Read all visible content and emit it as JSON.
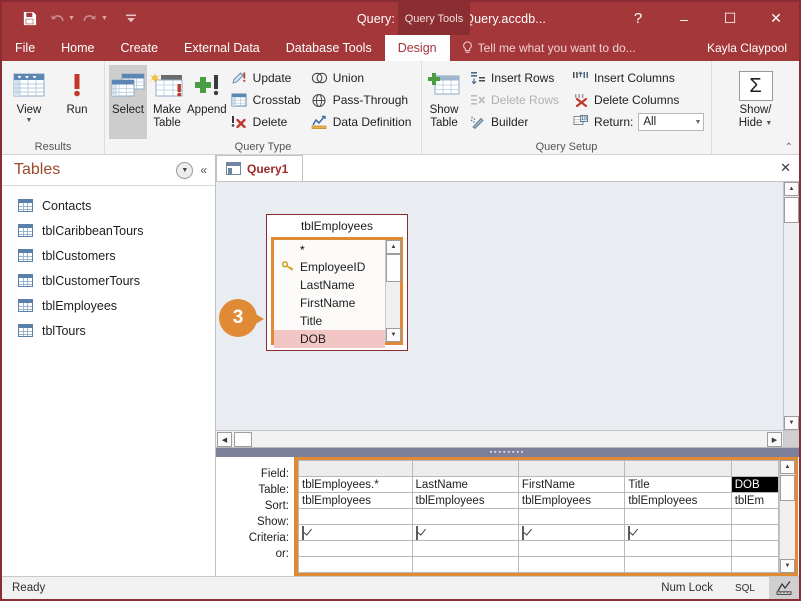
{
  "window": {
    "title": "Query: Database- \\Query.accdb...",
    "context_tab": "Query Tools",
    "quick_access": [
      {
        "name": "save-icon",
        "label": "Save"
      },
      {
        "name": "undo-icon",
        "label": "Undo"
      },
      {
        "name": "redo-icon",
        "label": "Redo"
      },
      {
        "name": "customize-qat-icon",
        "label": "Customize Quick Access Toolbar"
      }
    ],
    "controls": [
      {
        "name": "help-button",
        "label": "?"
      },
      {
        "name": "minimize-button",
        "label": "–"
      },
      {
        "name": "restore-button",
        "label": "☐"
      },
      {
        "name": "close-button",
        "label": "✕"
      }
    ]
  },
  "ribbon": {
    "tabs": [
      {
        "label": "File",
        "active": false
      },
      {
        "label": "Home",
        "active": false
      },
      {
        "label": "Create",
        "active": false
      },
      {
        "label": "External Data",
        "active": false
      },
      {
        "label": "Database Tools",
        "active": false
      },
      {
        "label": "Design",
        "active": true
      }
    ],
    "tell_me": "Tell me what you want to do...",
    "account": "Kayla Claypool",
    "groups": [
      {
        "label": "Results",
        "buttons": [
          {
            "label": "View",
            "name": "view-button",
            "has_dropdown": true
          },
          {
            "label": "Run",
            "name": "run-button",
            "has_dropdown": false
          }
        ]
      },
      {
        "label": "Query Type",
        "big_buttons": [
          {
            "label": "Select",
            "name": "select-query-button",
            "selected": true
          },
          {
            "label": "Make\nTable",
            "name": "make-table-query-button",
            "selected": false
          },
          {
            "label": "Append",
            "name": "append-query-button",
            "selected": false
          }
        ],
        "small_buttons_col1": [
          {
            "label": "Update",
            "name": "update-query-button",
            "disabled": false
          },
          {
            "label": "Crosstab",
            "name": "crosstab-query-button",
            "disabled": false
          },
          {
            "label": "Delete",
            "name": "delete-query-button",
            "disabled": false
          }
        ],
        "small_buttons_col2": [
          {
            "label": "Union",
            "name": "union-query-button",
            "disabled": false
          },
          {
            "label": "Pass-Through",
            "name": "pass-through-query-button",
            "disabled": false
          },
          {
            "label": "Data Definition",
            "name": "data-definition-query-button",
            "disabled": false
          }
        ]
      },
      {
        "label": "Query Setup",
        "show_table": "Show\nTable",
        "show_table_line1": "Show",
        "show_table_line2": "Table",
        "small_buttons_col1": [
          {
            "label": "Insert Rows",
            "name": "insert-rows-button",
            "disabled": false
          },
          {
            "label": "Delete Rows",
            "name": "delete-rows-button",
            "disabled": true
          },
          {
            "label": "Builder",
            "name": "builder-button",
            "disabled": false
          }
        ],
        "small_buttons_col2": [
          {
            "label": "Insert Columns",
            "name": "insert-columns-button",
            "disabled": false
          },
          {
            "label": "Delete Columns",
            "name": "delete-columns-button",
            "disabled": false
          }
        ],
        "return_label": "Return:",
        "return_value": "All"
      },
      {
        "label": "",
        "show_hide_line1": "Show/",
        "show_hide_line2": "Hide",
        "totals_symbol": "Σ"
      }
    ],
    "collapse_label": "⌃"
  },
  "navpane": {
    "title": "Tables",
    "items": [
      {
        "label": "Contacts",
        "name": "nav-item-contacts"
      },
      {
        "label": "tblCaribbeanTours",
        "name": "nav-item-tblcaribbeantours"
      },
      {
        "label": "tblCustomers",
        "name": "nav-item-tblcustomers"
      },
      {
        "label": "tblCustomerTours",
        "name": "nav-item-tblcustomertours"
      },
      {
        "label": "tblEmployees",
        "name": "nav-item-tblemployees"
      },
      {
        "label": "tblTours",
        "name": "nav-item-tbltours"
      }
    ]
  },
  "document": {
    "tab_label": "Query1",
    "close_label": "✕"
  },
  "field_list": {
    "table_name": "tblEmployees",
    "fields": [
      {
        "label": "*",
        "key": false,
        "selected": false
      },
      {
        "label": "EmployeeID",
        "key": true,
        "selected": false
      },
      {
        "label": "LastName",
        "key": false,
        "selected": false
      },
      {
        "label": "FirstName",
        "key": false,
        "selected": false
      },
      {
        "label": "Title",
        "key": false,
        "selected": false
      },
      {
        "label": "DOB",
        "key": false,
        "selected": true
      }
    ]
  },
  "callout": {
    "number": "3"
  },
  "query_grid": {
    "row_labels": [
      "Field:",
      "Table:",
      "Sort:",
      "Show:",
      "Criteria:",
      "or:"
    ],
    "columns": [
      {
        "field": "tblEmployees.*",
        "table": "tblEmployees",
        "sort": "",
        "show": true,
        "criteria": "",
        "or": "",
        "field_selected": false
      },
      {
        "field": "LastName",
        "table": "tblEmployees",
        "sort": "",
        "show": true,
        "criteria": "",
        "or": "",
        "field_selected": false
      },
      {
        "field": "FirstName",
        "table": "tblEmployees",
        "sort": "",
        "show": true,
        "criteria": "",
        "or": "",
        "field_selected": false
      },
      {
        "field": "Title",
        "table": "tblEmployees",
        "sort": "",
        "show": true,
        "criteria": "",
        "or": "",
        "field_selected": false
      },
      {
        "field": "DOB",
        "table": "tblEm",
        "sort": "",
        "show": false,
        "criteria": "",
        "or": "",
        "field_selected": true
      }
    ]
  },
  "statusbar": {
    "message": "Ready",
    "num_lock": "Num Lock",
    "sql_label": "SQL",
    "design_view_icon": "design-view-icon"
  },
  "colors": {
    "accent_red": "#a4373a",
    "accent_dark_red": "#8a2e32",
    "highlight_orange": "#e08a35",
    "selection_pink": "#f3c6c6",
    "nav_title": "#9c4a2d",
    "tab_text": "#9c2b2b",
    "design_surface": "#e9ecf0",
    "splitter": "#7e7f9b"
  }
}
